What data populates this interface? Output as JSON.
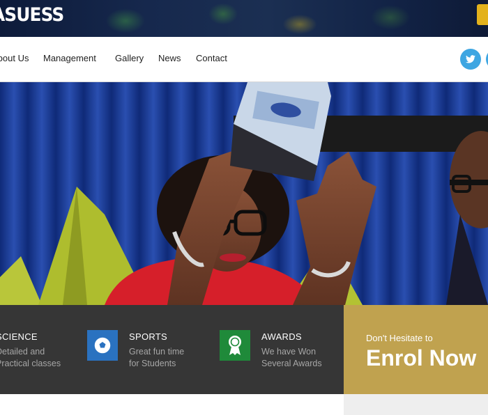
{
  "brand": {
    "logo_text": "ASUESS"
  },
  "nav": {
    "items": [
      {
        "label": "About Us"
      },
      {
        "label": "Management"
      },
      {
        "label": "Gallery"
      },
      {
        "label": "News"
      },
      {
        "label": "Contact"
      }
    ]
  },
  "social": [
    {
      "icon": "twitter-icon"
    },
    {
      "icon": "social-icon"
    }
  ],
  "hero": {
    "image": "award-presentation-photo"
  },
  "features": [
    {
      "title": "SCIENCE",
      "desc_line1": "Detailed and",
      "desc_line2": "Practical classes",
      "icon": "science-icon"
    },
    {
      "title": "SPORTS",
      "desc_line1": "Great fun time",
      "desc_line2": "for Students",
      "icon": "soccer-ball-icon",
      "icon_color": "#2a72c0"
    },
    {
      "title": "AWARDS",
      "desc_line1": "We have Won",
      "desc_line2": "Several Awards",
      "icon": "award-ribbon-icon",
      "icon_color": "#1f8a3a"
    }
  ],
  "enrol": {
    "small_text": "Don't Hesitate to",
    "big_text": "Enrol Now"
  },
  "colors": {
    "enrol_bg": "#c0a24f",
    "feature_bg": "#363636",
    "twitter_blue": "#3ea6e2"
  }
}
